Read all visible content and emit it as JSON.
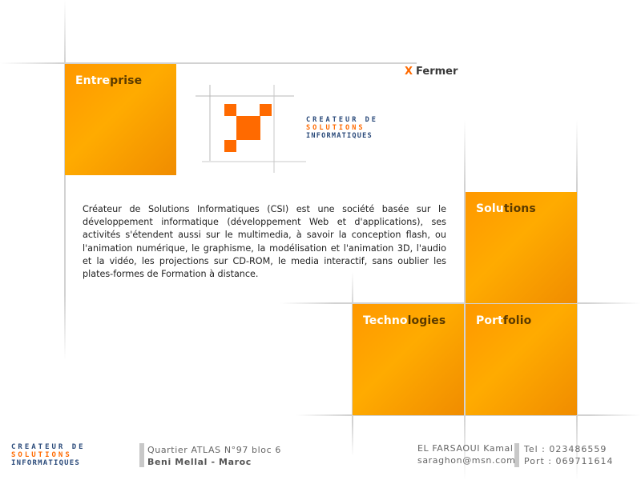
{
  "nav": {
    "entreprise": {
      "part1": "Entre",
      "part2": "prise"
    },
    "solutions": {
      "part1": "Solu",
      "part2": "tions"
    },
    "technologies": {
      "part1": "Techno",
      "part2": "logies"
    },
    "portfolio": {
      "part1": "Port",
      "part2": "folio"
    }
  },
  "close": {
    "icon": "X",
    "label": "Fermer"
  },
  "logo": {
    "line1": "CREATEUR DE",
    "line2": "SOLUTIONS",
    "line3": "INFORMATIQUES"
  },
  "main": {
    "paragraph": "Créateur de Solutions Informatiques (CSI) est une société basée sur le développement informatique (développement Web et d'applications), ses activités s'étendent aussi sur le multimedia, à savoir la conception flash, ou l'animation numérique, le graphisme, la modélisation et l'animation 3D, l'audio et la vidéo, les projections sur CD-ROM, le media interactif, sans oublier les plates-formes de Formation à distance."
  },
  "footer": {
    "address_line1": "Quartier ATLAS N°97 bloc 6",
    "address_line2": "Beni Mellal - Maroc",
    "contact_name": "EL FARSAOUI Kamal",
    "contact_email": "saraghon@msn.com",
    "tel": "Tel : 023486559",
    "port": "Port : 069711614"
  },
  "colors": {
    "accent": "#ff9900",
    "accent_dark": "#f07c00",
    "text_dark": "#5a3a00",
    "close_x": "#ff6a00"
  }
}
